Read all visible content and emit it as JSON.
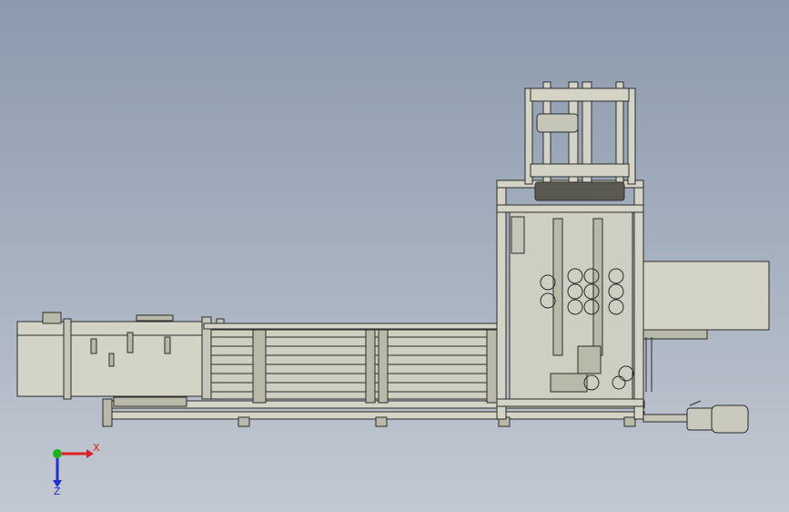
{
  "viewport": {
    "background_top": "#8c9aae",
    "background_bottom": "#c2c9d2"
  },
  "model": {
    "line_color": "#2b2b2b",
    "fill_color": "#d4d4c6",
    "fill_dark": "#b9b9aa",
    "motor_color": "#c9c9bd"
  },
  "triad": {
    "x_label": "X",
    "z_label": "Z",
    "x_color": "#e02020",
    "y_color": "#20b020",
    "z_color": "#2030d0"
  }
}
